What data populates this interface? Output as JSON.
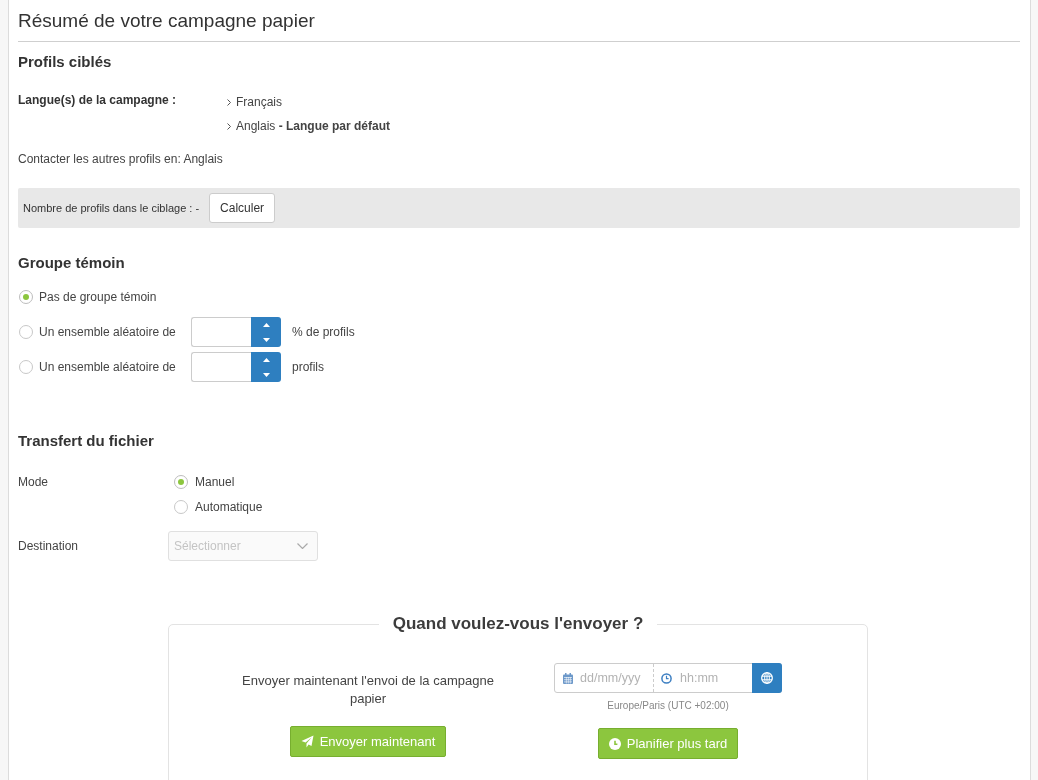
{
  "header": {
    "title": "Résumé de votre campagne papier"
  },
  "targeted_profiles": {
    "heading": "Profils ciblés",
    "languages_label": "Langue(s) de la campagne :",
    "languages": [
      "Français",
      "Anglais **- Langue par défaut**"
    ],
    "other_profiles": "Contacter les autres profils en: Anglais",
    "count": {
      "label": "Nombre de profils dans le ciblage : -",
      "button": "Calculer"
    }
  },
  "control_group": {
    "heading": "Groupe témoin",
    "options": [
      {
        "kind": "plain",
        "label": "Pas de groupe témoin",
        "selected": true
      },
      {
        "kind": "spinner",
        "label": "Un ensemble aléatoire de",
        "unit": "% de profils",
        "selected": false
      },
      {
        "kind": "spinner",
        "label": "Un ensemble aléatoire de",
        "unit": "profils",
        "selected": false
      }
    ]
  },
  "file_transfer": {
    "heading": "Transfert du fichier",
    "mode": {
      "label": "Mode",
      "options": [
        {
          "label": "Manuel",
          "selected": true
        },
        {
          "label": "Automatique",
          "selected": false
        }
      ]
    },
    "destination": {
      "label": "Destination",
      "placeholder": "Sélectionner",
      "disabled": true
    }
  },
  "schedule": {
    "legend": "Quand voulez-vous l'envoyer ?",
    "send_now": {
      "text": "Envoyer maintenant l'envoi de la campagne papier",
      "button": "Envoyer maintenant"
    },
    "schedule_later": {
      "date_placeholder": "dd/mm/yyy",
      "time_placeholder": "hh:mm",
      "timezone": "Europe/Paris (UTC +02:00)",
      "button": "Planifier plus tard"
    }
  }
}
